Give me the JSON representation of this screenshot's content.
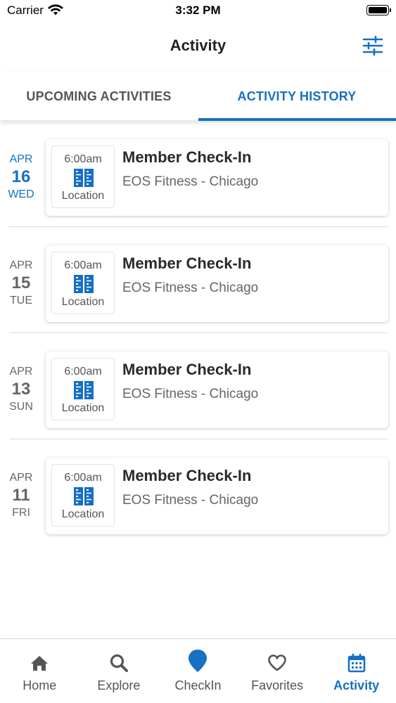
{
  "status_bar": {
    "carrier": "Carrier",
    "time": "3:32 PM"
  },
  "header": {
    "title": "Activity",
    "filter_icon": "sliders-icon"
  },
  "tabs": [
    {
      "label": "UPCOMING ACTIVITIES",
      "active": false
    },
    {
      "label": "ACTIVITY HISTORY",
      "active": true
    }
  ],
  "activities": [
    {
      "month": "APR",
      "day": "16",
      "weekday": "WED",
      "time": "6:00am",
      "location_label": "Location",
      "title": "Member Check-In",
      "subtitle": "EOS Fitness - Chicago",
      "highlighted": true
    },
    {
      "month": "APR",
      "day": "15",
      "weekday": "TUE",
      "time": "6:00am",
      "location_label": "Location",
      "title": "Member Check-In",
      "subtitle": "EOS Fitness - Chicago",
      "highlighted": false
    },
    {
      "month": "APR",
      "day": "13",
      "weekday": "SUN",
      "time": "6:00am",
      "location_label": "Location",
      "title": "Member Check-In",
      "subtitle": "EOS Fitness - Chicago",
      "highlighted": false
    },
    {
      "month": "APR",
      "day": "11",
      "weekday": "FRI",
      "time": "6:00am",
      "location_label": "Location",
      "title": "Member Check-In",
      "subtitle": "EOS Fitness - Chicago",
      "highlighted": false
    }
  ],
  "tab_bar": [
    {
      "label": "Home",
      "icon": "home-icon",
      "active": false
    },
    {
      "label": "Explore",
      "icon": "search-icon",
      "active": false
    },
    {
      "label": "CheckIn",
      "icon": "map-pin-icon",
      "active": false
    },
    {
      "label": "Favorites",
      "icon": "heart-icon",
      "active": false
    },
    {
      "label": "Activity",
      "icon": "calendar-icon",
      "active": true
    }
  ],
  "colors": {
    "accent": "#1670c4",
    "text_primary": "#2a2a2a",
    "text_secondary": "#666666",
    "divider": "#dadada"
  }
}
